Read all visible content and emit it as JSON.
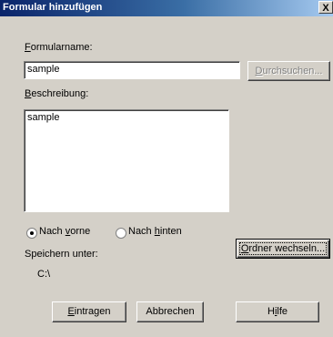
{
  "window": {
    "title": "Formular hinzufügen",
    "close_glyph": "X"
  },
  "form_name": {
    "label_first": "F",
    "label_rest": "ormularname:",
    "value": "sample"
  },
  "browse_button": {
    "label_first": "D",
    "label_rest": "urchsuchen..."
  },
  "description": {
    "label_first": "B",
    "label_rest": "eschreibung:",
    "value": "sample"
  },
  "position": {
    "front": {
      "label_pre": "Nach ",
      "label_u": "v",
      "label_post": "orne",
      "checked": true
    },
    "back": {
      "label_pre": "Nach ",
      "label_u": "h",
      "label_post": "inten",
      "checked": false
    }
  },
  "save_under": {
    "label": "Speichern unter:",
    "path": "C:\\"
  },
  "change_folder_button": {
    "label_first": "O",
    "label_rest": "rdner wechseln..."
  },
  "footer": {
    "enter_first": "E",
    "enter_rest": "intragen",
    "cancel": "Abbrechen",
    "help_pre": "H",
    "help_u": "i",
    "help_post": "lfe"
  }
}
